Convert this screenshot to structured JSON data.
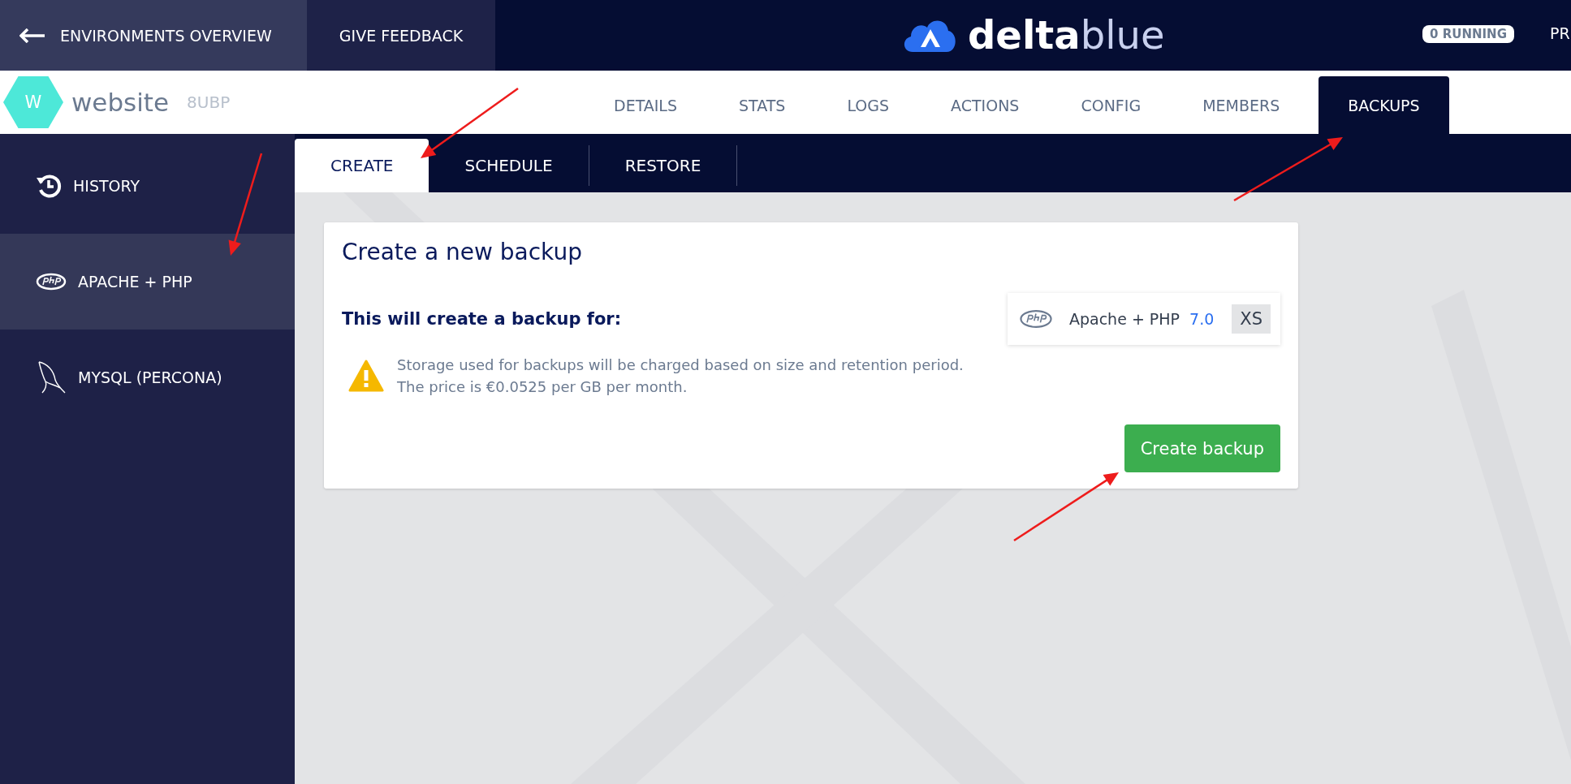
{
  "top_bar": {
    "buttons": [
      {
        "label": "ENVIRONMENTS OVERVIEW",
        "kind": "back"
      },
      {
        "label": "GIVE FEEDBACK",
        "kind": "plain"
      }
    ],
    "logo": {
      "first": "delta",
      "second": "blue"
    },
    "running_badge": "0 RUNNING",
    "profile_cut": "PR"
  },
  "environment": {
    "avatar": "W",
    "name": "website",
    "code": "8UBP"
  },
  "tabs": [
    {
      "label": "DETAILS",
      "selected": false
    },
    {
      "label": "STATS",
      "selected": false
    },
    {
      "label": "LOGS",
      "selected": false
    },
    {
      "label": "ACTIONS",
      "selected": false
    },
    {
      "label": "CONFIG",
      "selected": false
    },
    {
      "label": "MEMBERS",
      "selected": false
    },
    {
      "label": "BACKUPS",
      "selected": true
    }
  ],
  "sidebar": {
    "items": [
      {
        "label": "HISTORY",
        "kind": "history",
        "selected": false
      },
      {
        "label": "APACHE + PHP",
        "kind": "php",
        "selected": true
      },
      {
        "label": "MYSQL (PERCONA)",
        "kind": "mysql",
        "selected": false
      }
    ]
  },
  "subtabs": [
    {
      "label": "CREATE",
      "selected": true
    },
    {
      "label": "SCHEDULE",
      "selected": false
    },
    {
      "label": "RESTORE",
      "selected": false
    }
  ],
  "card": {
    "title": "Create a new backup",
    "target_label": "This will create a backup for:",
    "component": {
      "name": "Apache + PHP",
      "version": "7.0",
      "size": "XS"
    },
    "warning": [
      "Storage used for backups will be charged based on size and retention period.",
      "The price is €0.0525 per GB per month."
    ],
    "button": "Create backup"
  }
}
